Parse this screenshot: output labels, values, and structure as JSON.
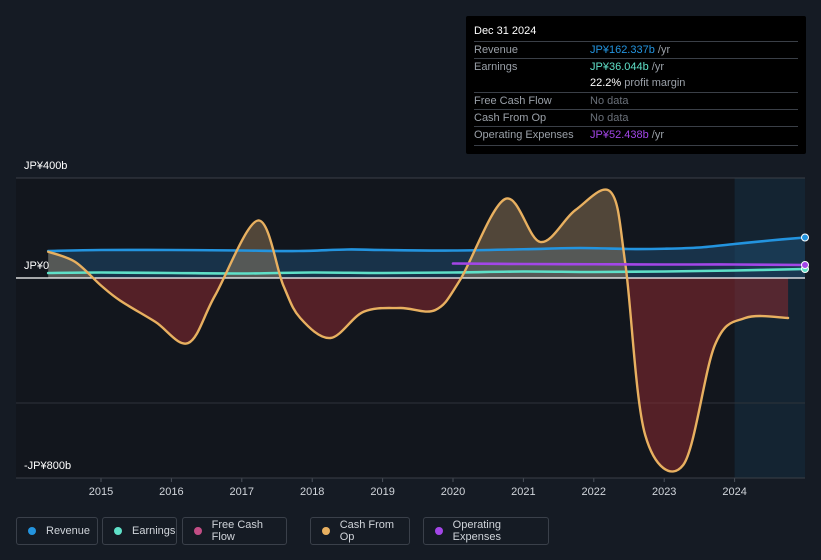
{
  "tooltip": {
    "date": "Dec 31 2024",
    "rows": [
      {
        "label": "Revenue",
        "value": "JP¥162.337b",
        "unit": " /yr",
        "color": "#2394df"
      },
      {
        "label": "Earnings",
        "value": "JP¥36.044b",
        "unit": " /yr",
        "color": "#5fe0c8"
      },
      {
        "label": "",
        "value": "22.2%",
        "unit": " profit margin",
        "color": "#ffffff"
      },
      {
        "label": "Free Cash Flow",
        "value": "No data",
        "unit": "",
        "color": "#6b717a"
      },
      {
        "label": "Cash From Op",
        "value": "No data",
        "unit": "",
        "color": "#6b717a"
      },
      {
        "label": "Operating Expenses",
        "value": "JP¥52.438b",
        "unit": " /yr",
        "color": "#a346e8"
      }
    ]
  },
  "legend": [
    {
      "label": "Revenue",
      "color": "#2394df"
    },
    {
      "label": "Earnings",
      "color": "#5fe0c8"
    },
    {
      "label": "Free Cash Flow",
      "color": "#c24d85"
    },
    {
      "label": "Cash From Op",
      "color": "#e8b060"
    },
    {
      "label": "Operating Expenses",
      "color": "#a346e8"
    }
  ],
  "chart_data": {
    "type": "area",
    "title": "",
    "xlabel": "",
    "ylabel": "",
    "ylim": [
      -800,
      400
    ],
    "y_unit": "JP¥ billions",
    "y_tick_labels": [
      "JP¥400b",
      "JP¥0",
      "-JP¥800b"
    ],
    "x_tick_labels": [
      "2015",
      "2016",
      "2017",
      "2018",
      "2019",
      "2020",
      "2021",
      "2022",
      "2023",
      "2024"
    ],
    "xlim": [
      2014.25,
      2025.0
    ],
    "forecast_shade_start": 2024.0,
    "series": [
      {
        "name": "Revenue",
        "color": "#2394df",
        "x": [
          2014.25,
          2015.0,
          2016.0,
          2017.0,
          2017.8,
          2018.5,
          2019.0,
          2020.0,
          2021.0,
          2021.8,
          2022.5,
          2023.0,
          2023.5,
          2024.0,
          2024.5,
          2025.0
        ],
        "values": [
          108,
          112,
          112,
          110,
          108,
          114,
          112,
          110,
          115,
          120,
          116,
          117,
          122,
          136,
          150,
          162
        ]
      },
      {
        "name": "Earnings",
        "color": "#5fe0c8",
        "x": [
          2014.25,
          2015.0,
          2016.0,
          2017.0,
          2018.0,
          2019.0,
          2020.0,
          2021.0,
          2022.0,
          2023.0,
          2024.0,
          2025.0
        ],
        "values": [
          20,
          22,
          20,
          18,
          22,
          20,
          22,
          26,
          24,
          26,
          30,
          36
        ]
      },
      {
        "name": "Free Cash Flow",
        "color": "#c24d85",
        "x": [],
        "values": []
      },
      {
        "name": "Cash From Op",
        "color": "#e8b060",
        "x": [
          2014.25,
          2014.63,
          2015.0,
          2015.27,
          2015.77,
          2016.24,
          2016.62,
          2017.23,
          2017.59,
          2017.83,
          2018.26,
          2018.73,
          2019.25,
          2019.75,
          2020.1,
          2020.74,
          2021.24,
          2021.74,
          2022.24,
          2022.45,
          2022.73,
          2023.27,
          2023.72,
          2024.15,
          2024.76
        ],
        "values": [
          105,
          65,
          -30,
          -90,
          -175,
          -260,
          -70,
          230,
          -30,
          -160,
          -240,
          -135,
          -120,
          -128,
          -8,
          316,
          144,
          272,
          344,
          52,
          -628,
          -748,
          -268,
          -160,
          -160
        ]
      },
      {
        "name": "Operating Expenses",
        "color": "#a346e8",
        "x": [
          2020.0,
          2021.0,
          2022.0,
          2023.0,
          2024.0,
          2025.0
        ],
        "values": [
          58,
          56,
          55,
          54,
          54,
          52
        ]
      }
    ]
  }
}
